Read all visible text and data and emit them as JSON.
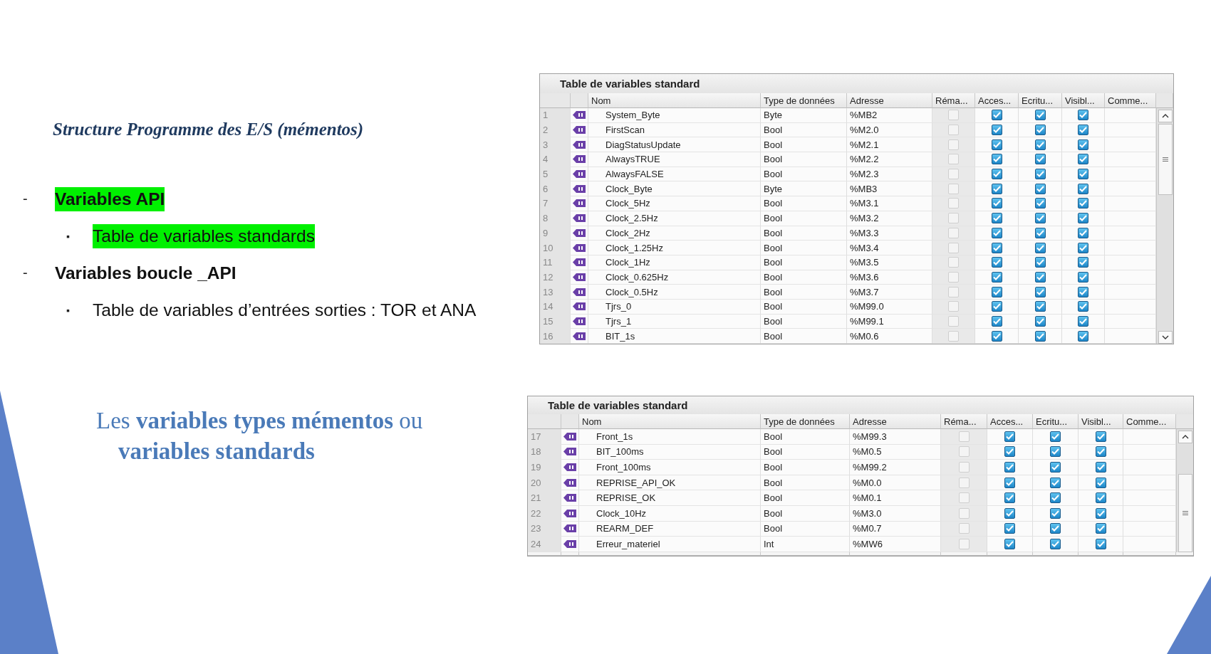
{
  "slide_title": "Structure Programme des E/S  (mémentos)",
  "bullets": [
    {
      "marker": "-",
      "text": "Variables API",
      "kind": "main",
      "highlighted": true
    },
    {
      "marker": "▪",
      "text": "Table de variables standards",
      "kind": "sub",
      "highlighted": true
    },
    {
      "marker": "-",
      "text": "Variables boucle _API",
      "kind": "main",
      "highlighted": false
    },
    {
      "marker": "▪",
      "text": "Table de variables d’entrées sorties : TOR et ANA",
      "kind": "sub",
      "highlighted": false
    }
  ],
  "caption": [
    "Les **variables types mémentos** ou",
    "**variables standards**"
  ],
  "tables": [
    {
      "title": "Table de variables standard",
      "columns": [
        "Nom",
        "Type de données",
        "Adresse",
        "Réma...",
        "Acces...",
        "Ecritu...",
        "Visibl...",
        "Comme..."
      ],
      "rows": [
        {
          "number": "1",
          "name": "System_Byte",
          "type": "Byte",
          "address": "%MB2",
          "retain": false,
          "accessible": true,
          "writable": true,
          "visible": true
        },
        {
          "number": "2",
          "name": "FirstScan",
          "type": "Bool",
          "address": "%M2.0",
          "retain": false,
          "accessible": true,
          "writable": true,
          "visible": true
        },
        {
          "number": "3",
          "name": "DiagStatusUpdate",
          "type": "Bool",
          "address": "%M2.1",
          "retain": false,
          "accessible": true,
          "writable": true,
          "visible": true
        },
        {
          "number": "4",
          "name": "AlwaysTRUE",
          "type": "Bool",
          "address": "%M2.2",
          "retain": false,
          "accessible": true,
          "writable": true,
          "visible": true
        },
        {
          "number": "5",
          "name": "AlwaysFALSE",
          "type": "Bool",
          "address": "%M2.3",
          "retain": false,
          "accessible": true,
          "writable": true,
          "visible": true
        },
        {
          "number": "6",
          "name": "Clock_Byte",
          "type": "Byte",
          "address": "%MB3",
          "retain": false,
          "accessible": true,
          "writable": true,
          "visible": true
        },
        {
          "number": "7",
          "name": "Clock_5Hz",
          "type": "Bool",
          "address": "%M3.1",
          "retain": false,
          "accessible": true,
          "writable": true,
          "visible": true
        },
        {
          "number": "8",
          "name": "Clock_2.5Hz",
          "type": "Bool",
          "address": "%M3.2",
          "retain": false,
          "accessible": true,
          "writable": true,
          "visible": true
        },
        {
          "number": "9",
          "name": "Clock_2Hz",
          "type": "Bool",
          "address": "%M3.3",
          "retain": false,
          "accessible": true,
          "writable": true,
          "visible": true
        },
        {
          "number": "10",
          "name": "Clock_1.25Hz",
          "type": "Bool",
          "address": "%M3.4",
          "retain": false,
          "accessible": true,
          "writable": true,
          "visible": true
        },
        {
          "number": "11",
          "name": "Clock_1Hz",
          "type": "Bool",
          "address": "%M3.5",
          "retain": false,
          "accessible": true,
          "writable": true,
          "visible": true
        },
        {
          "number": "12",
          "name": "Clock_0.625Hz",
          "type": "Bool",
          "address": "%M3.6",
          "retain": false,
          "accessible": true,
          "writable": true,
          "visible": true
        },
        {
          "number": "13",
          "name": "Clock_0.5Hz",
          "type": "Bool",
          "address": "%M3.7",
          "retain": false,
          "accessible": true,
          "writable": true,
          "visible": true
        },
        {
          "number": "14",
          "name": "Tjrs_0",
          "type": "Bool",
          "address": "%M99.0",
          "retain": false,
          "accessible": true,
          "writable": true,
          "visible": true
        },
        {
          "number": "15",
          "name": "Tjrs_1",
          "type": "Bool",
          "address": "%M99.1",
          "retain": false,
          "accessible": true,
          "writable": true,
          "visible": true
        },
        {
          "number": "16",
          "name": "BIT_1s",
          "type": "Bool",
          "address": "%M0.6",
          "retain": false,
          "accessible": true,
          "writable": true,
          "visible": true
        }
      ]
    },
    {
      "title": "Table de variables standard",
      "columns": [
        "Nom",
        "Type de données",
        "Adresse",
        "Réma...",
        "Acces...",
        "Ecritu...",
        "Visibl...",
        "Comme..."
      ],
      "rows": [
        {
          "number": "17",
          "name": "Front_1s",
          "type": "Bool",
          "address": "%M99.3",
          "retain": false,
          "accessible": true,
          "writable": true,
          "visible": true
        },
        {
          "number": "18",
          "name": "BIT_100ms",
          "type": "Bool",
          "address": "%M0.5",
          "retain": false,
          "accessible": true,
          "writable": true,
          "visible": true
        },
        {
          "number": "19",
          "name": "Front_100ms",
          "type": "Bool",
          "address": "%M99.2",
          "retain": false,
          "accessible": true,
          "writable": true,
          "visible": true
        },
        {
          "number": "20",
          "name": "REPRISE_API_OK",
          "type": "Bool",
          "address": "%M0.0",
          "retain": false,
          "accessible": true,
          "writable": true,
          "visible": true
        },
        {
          "number": "21",
          "name": "REPRISE_OK",
          "type": "Bool",
          "address": "%M0.1",
          "retain": false,
          "accessible": true,
          "writable": true,
          "visible": true
        },
        {
          "number": "22",
          "name": "Clock_10Hz",
          "type": "Bool",
          "address": "%M3.0",
          "retain": false,
          "accessible": true,
          "writable": true,
          "visible": true
        },
        {
          "number": "23",
          "name": "REARM_DEF",
          "type": "Bool",
          "address": "%M0.7",
          "retain": false,
          "accessible": true,
          "writable": true,
          "visible": true
        },
        {
          "number": "24",
          "name": "Erreur_materiel",
          "type": "Int",
          "address": "%MW6",
          "retain": false,
          "accessible": true,
          "writable": true,
          "visible": true
        }
      ]
    }
  ]
}
